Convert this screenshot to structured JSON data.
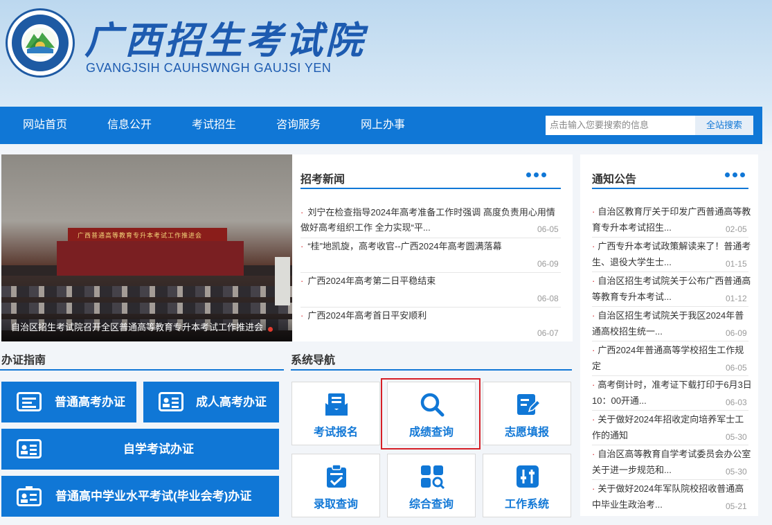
{
  "header": {
    "title": "广西招生考试院",
    "subtitle": "GVANGJSIH CAUHSWNGH GAUJSI YEN",
    "seal_text": "广西招生考试院 GVANGJSIH CAUHSWNGH GAUJSI YEN"
  },
  "nav": {
    "items": [
      "网站首页",
      "信息公开",
      "考试招生",
      "咨询服务",
      "网上办事"
    ],
    "search_placeholder": "点击输入您要搜索的信息",
    "search_button": "全站搜索"
  },
  "banner": {
    "caption": "自治区招生考试院召开全区普通高等教育专升本考试工作推进会",
    "screen_text": "广西普通高等教育专升本考试工作推进会"
  },
  "news": {
    "title": "招考新闻",
    "items": [
      {
        "text": "刘宁在检查指导2024年高考准备工作时强调 高度负责用心用情做好高考组织工作 全力实现“平...",
        "date": "06-05"
      },
      {
        "text": "“桂”地凯旋，高考收官--广西2024年高考圆满落幕",
        "date": "06-09"
      },
      {
        "text": "广西2024年高考第二日平稳结束",
        "date": "06-08"
      },
      {
        "text": "广西2024年高考首日平安顺利",
        "date": "06-07"
      }
    ]
  },
  "notices": {
    "title": "通知公告",
    "items": [
      {
        "text": "自治区教育厅关于印发广西普通高等教育专升本考试招生...",
        "date": "02-05"
      },
      {
        "text": "广西专升本考试政策解读来了！普通考生、退役大学生士...",
        "date": "01-15"
      },
      {
        "text": "自治区招生考试院关于公布广西普通高等教育专升本考试...",
        "date": "01-12"
      },
      {
        "text": "自治区招生考试院关于我区2024年普通高校招生统一...",
        "date": "06-09"
      },
      {
        "text": "广西2024年普通高等学校招生工作规定",
        "date": "06-05"
      },
      {
        "text": "高考倒计时，准考证下载打印于6月3日10：00开通...",
        "date": "06-03"
      },
      {
        "text": "关于做好2024年招收定向培养军士工作的通知",
        "date": "05-30"
      },
      {
        "text": "自治区高等教育自学考试委员会办公室关于进一步规范和...",
        "date": "05-30"
      },
      {
        "text": "关于做好2024年军队院校招收普通高中毕业生政治考...",
        "date": "05-21"
      }
    ]
  },
  "guide": {
    "title": "办证指南",
    "buttons": [
      "普通高考办证",
      "成人高考办证",
      "自学考试办证",
      "普通高中学业水平考试(毕业会考)办证"
    ]
  },
  "system_nav": {
    "title": "系统导航",
    "tiles": [
      "考试报名",
      "成绩查询",
      "志愿填报",
      "录取查询",
      "综合查询",
      "工作系统"
    ]
  },
  "colors": {
    "primary": "#1077d6",
    "bullet": "#d6232b",
    "highlight": "#d61f26"
  }
}
